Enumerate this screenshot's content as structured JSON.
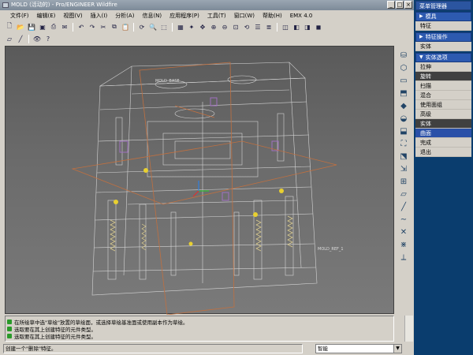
{
  "window": {
    "title": "MOLD (活动的) - Pro/ENGINEER Wildfire"
  },
  "menubar": [
    "文件(F)",
    "编辑(E)",
    "视图(V)",
    "插入(I)",
    "分析(A)",
    "信息(N)",
    "应用程序(P)",
    "工具(T)",
    "窗口(W)",
    "帮助(H)",
    "EMX 4.0"
  ],
  "toolbar1_icons": [
    "new-file-icon",
    "open-icon",
    "save-icon",
    "save-copy-icon",
    "print-icon",
    "email-icon",
    "cut-icon",
    "copy-icon",
    "paste-icon",
    "undo-icon",
    "redo-icon",
    "regenerate-icon",
    "find-icon",
    "select-box-icon",
    "repaint-icon",
    "spin-center-icon",
    "orient-icon",
    "zoom-in-icon",
    "zoom-out-icon",
    "refit-icon",
    "reorient-icon",
    "view-list-icon",
    "layers-icon",
    "wireframe-icon",
    "hidden-line-icon",
    "no-hidden-icon",
    "shading-icon"
  ],
  "toolbar2_icons": [
    "datum-plane-icon",
    "datum-axis-icon",
    "eye-icon",
    "help-cursor-icon"
  ],
  "viewport": {
    "annotation_top": "MOLD_BASE",
    "annotation_right": "MOLD_REF_1"
  },
  "messages": [
    "在所绘草中选\"草绘\"放置的草绘面，或选择草绘基准面或使用副本作为草绘。",
    "选取要在其上创建特征的元件类型。",
    "选取要在其上创建特征的元件类型。"
  ],
  "status": {
    "text": "创建一个\"删除\"特征。",
    "filter": "智能"
  },
  "menu_manager": {
    "title": "菜单管理器",
    "sec_feature": "模具",
    "item_feature": "特征",
    "sec_feature_op": "特征操作",
    "item_assembly": "实体",
    "sec_solid": "实体选项",
    "items": [
      "拉伸",
      "旋转",
      "扫描",
      "混合",
      "使用面组",
      "高级",
      "实体",
      "曲面",
      "完成",
      "退出"
    ]
  }
}
